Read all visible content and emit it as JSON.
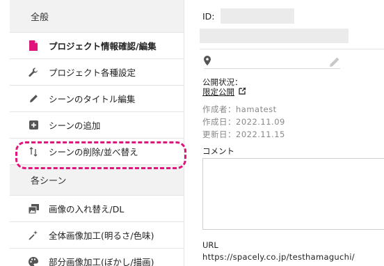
{
  "sidebar": {
    "section_general": "全般",
    "items_general": [
      {
        "label": "プロジェクト情報確認/編集",
        "icon": "document-icon",
        "active": true
      },
      {
        "label": "プロジェクト各種設定",
        "icon": "wrench-icon"
      },
      {
        "label": "シーンのタイトル編集",
        "icon": "pencil-icon"
      },
      {
        "label": "シーンの追加",
        "icon": "plus-square-icon"
      },
      {
        "label": "シーンの削除/並べ替え",
        "icon": "sort-arrows-icon",
        "highlighted": true
      }
    ],
    "section_scenes": "各シーン",
    "items_scenes": [
      {
        "label": "画像の入れ替え/DL",
        "icon": "images-icon"
      },
      {
        "label": "全体画像加工(明るさ/色味)",
        "icon": "magic-wand-icon"
      },
      {
        "label": "部分画像加工(ぼかし/描画)",
        "icon": "palette-icon"
      }
    ]
  },
  "main": {
    "id_label": "ID:",
    "public_status_label": "公開状況：",
    "public_status_value": "限定公開",
    "author": "作成者：hamatest",
    "created": "作成日：2022.11.09",
    "updated": "更新日：2022.11.15",
    "comment_label": "コメント",
    "url_label": "URL",
    "url_value": "https://spacely.co.jp/testhamaguchi/"
  },
  "colors": {
    "accent": "#e0147a",
    "active_icon": "#e0147a",
    "icon_gray": "#555555",
    "section_bg": "#f2f2f2"
  }
}
